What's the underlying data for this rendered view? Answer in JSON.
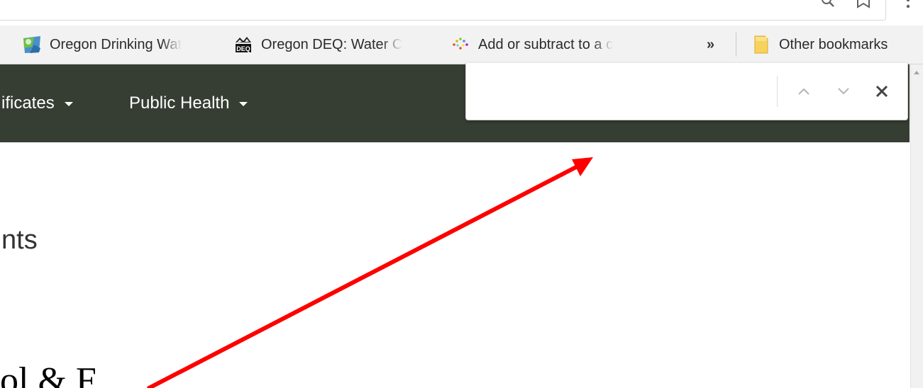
{
  "browser": {
    "find_bar": {
      "query": "",
      "match_count": "",
      "prev_icon": "chevron-up-icon",
      "next_icon": "chevron-down-icon",
      "close_icon": "close-icon"
    },
    "toolbar_icons": [
      "zoom-icon",
      "bookmark-star-icon",
      "menu-icon"
    ]
  },
  "bookmarks_bar": {
    "items": [
      {
        "label": "Oregon Drinking Wat",
        "icon": "geo-map-icon"
      },
      {
        "label": "Oregon DEQ: Water C",
        "icon": "deq-logo-icon"
      },
      {
        "label": "Add or subtract to a c",
        "icon": "sparkle-icon"
      }
    ],
    "overflow_label": "»",
    "other": {
      "label": "Other bookmarks",
      "icon": "folder-icon"
    }
  },
  "site_nav": {
    "items": [
      {
        "label": "ificates"
      },
      {
        "label": "Public Health"
      }
    ],
    "background": "#363e33"
  },
  "content": {
    "heading_fragment": "nts",
    "subheading_fragment": "ol & F"
  },
  "annotation": {
    "type": "arrow",
    "color": "#ff0000"
  }
}
